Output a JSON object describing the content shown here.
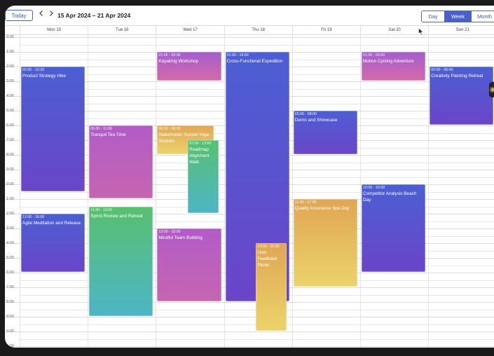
{
  "toolbar": {
    "today_label": "Today",
    "prev_icon": "chevron-left-icon",
    "next_icon": "chevron-right-icon",
    "date_range": "15 Apr 2024 – 21 Apr 2024",
    "views": [
      "Day",
      "Week",
      "Month"
    ],
    "active_view": "Week"
  },
  "days": [
    "Mon 15",
    "Tue 16",
    "Wed 17",
    "Thu 18",
    "Fri 19",
    "Sat 20",
    "Sun 21"
  ],
  "hours": [
    "0:00",
    "1:00",
    "2:00",
    "3:00",
    "4:00",
    "5:00",
    "6:00",
    "7:00",
    "8:00",
    "9:00",
    "0:00",
    "1:00",
    "2:00",
    "3:00",
    "4:00",
    "5:00",
    "6:00",
    "7:00",
    "8:00",
    "9:00",
    "0:00",
    "1:00"
  ],
  "events": [
    {
      "day": 0,
      "start": 2,
      "end": 10.5,
      "time": "02:00 - 10:20",
      "title": "Product Strategy Hike",
      "color": "blue"
    },
    {
      "day": 0,
      "start": 12,
      "end": 16,
      "time": "12:00 - 16:00",
      "title": "Agile Meditation and Release",
      "color": "blue"
    },
    {
      "day": 1,
      "start": 6,
      "end": 11,
      "time": "06:00 - 11:00",
      "title": "Tranquil Tea Time",
      "color": "mag"
    },
    {
      "day": 1,
      "start": 11.5,
      "end": 19,
      "time": "11:30 - 19:00",
      "title": "Sprint Review and Retreat",
      "color": "green"
    },
    {
      "day": 2,
      "start": 1,
      "end": 3,
      "time": "01:00 - 03:00",
      "title": "Kayaking Workshop",
      "color": "purple"
    },
    {
      "day": 2,
      "start": 6,
      "end": 8,
      "width": 0.88,
      "time": "06:00 - 08:00",
      "title": "Stakeholder Sunset Yoga Session",
      "color": "orange"
    },
    {
      "day": 2,
      "start": 7,
      "end": 12,
      "left": 0.48,
      "width": 0.48,
      "time": "07:00 - 12:00",
      "title": "Roadmap Alignment Walk",
      "color": "green"
    },
    {
      "day": 2,
      "start": 13,
      "end": 18,
      "time": "13:00 - 18:00",
      "title": "Mindful Team Building",
      "color": "mag"
    },
    {
      "day": 3,
      "start": 1,
      "end": 18,
      "time": "01:00 - 18:00",
      "title": "Cross-Functional Expedition",
      "color": "blue"
    },
    {
      "day": 3,
      "start": 14,
      "end": 20,
      "left": 0.48,
      "width": 0.48,
      "time": "14:00 - 20:00",
      "title": "User Feedback Picnic",
      "color": "orange"
    },
    {
      "day": 4,
      "start": 5,
      "end": 8,
      "time": "05:00 - 08:00",
      "title": "Demo and Showcase",
      "color": "blue"
    },
    {
      "day": 4,
      "start": 11,
      "end": 17,
      "time": "11:00 - 17:00",
      "title": "Quality Assurance Spa Day",
      "color": "orange"
    },
    {
      "day": 5,
      "start": 1,
      "end": 3,
      "time": "01:00 - 03:00",
      "title": "Motion Cycling Adventure",
      "color": "purple"
    },
    {
      "day": 5,
      "start": 10,
      "end": 16,
      "time": "10:00 - 16:00",
      "title": "Competitor Analysis Beach Day",
      "color": "blue"
    },
    {
      "day": 6,
      "start": 2,
      "end": 6,
      "time": "02:00 - 06:00",
      "title": "Creativity Painting Retreat",
      "color": "blue"
    }
  ]
}
